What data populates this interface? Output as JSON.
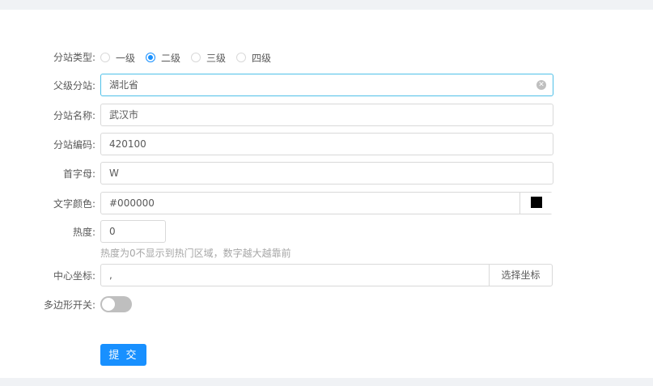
{
  "form": {
    "type": {
      "label": "分站类型:",
      "options": [
        "一级",
        "二级",
        "三级",
        "四级"
      ],
      "selected": "二级"
    },
    "parent": {
      "label": "父级分站:",
      "value": "湖北省"
    },
    "name": {
      "label": "分站名称:",
      "value": "武汉市"
    },
    "code": {
      "label": "分站编码:",
      "value": "420100"
    },
    "initial": {
      "label": "首字母:",
      "value": "W"
    },
    "color": {
      "label": "文字颜色:",
      "value": "#000000",
      "swatch": "#000000"
    },
    "hot": {
      "label": "热度:",
      "value": "0",
      "helper": "热度为0不显示到热门区域，数字越大越靠前"
    },
    "center": {
      "label": "中心坐标:",
      "value": ",",
      "button": "选择坐标"
    },
    "polygon": {
      "label": "多边形开关:",
      "enabled": false
    },
    "submit": "提 交"
  },
  "colors": {
    "accent": "#1890ff",
    "focus_border": "#4fc0e8",
    "border": "#d9d9d9",
    "helper_text": "#a6a6a6",
    "page_background": "#f0f2f5"
  },
  "icons": {
    "clear": "circle-close-icon",
    "color_swatch": "color-swatch"
  }
}
